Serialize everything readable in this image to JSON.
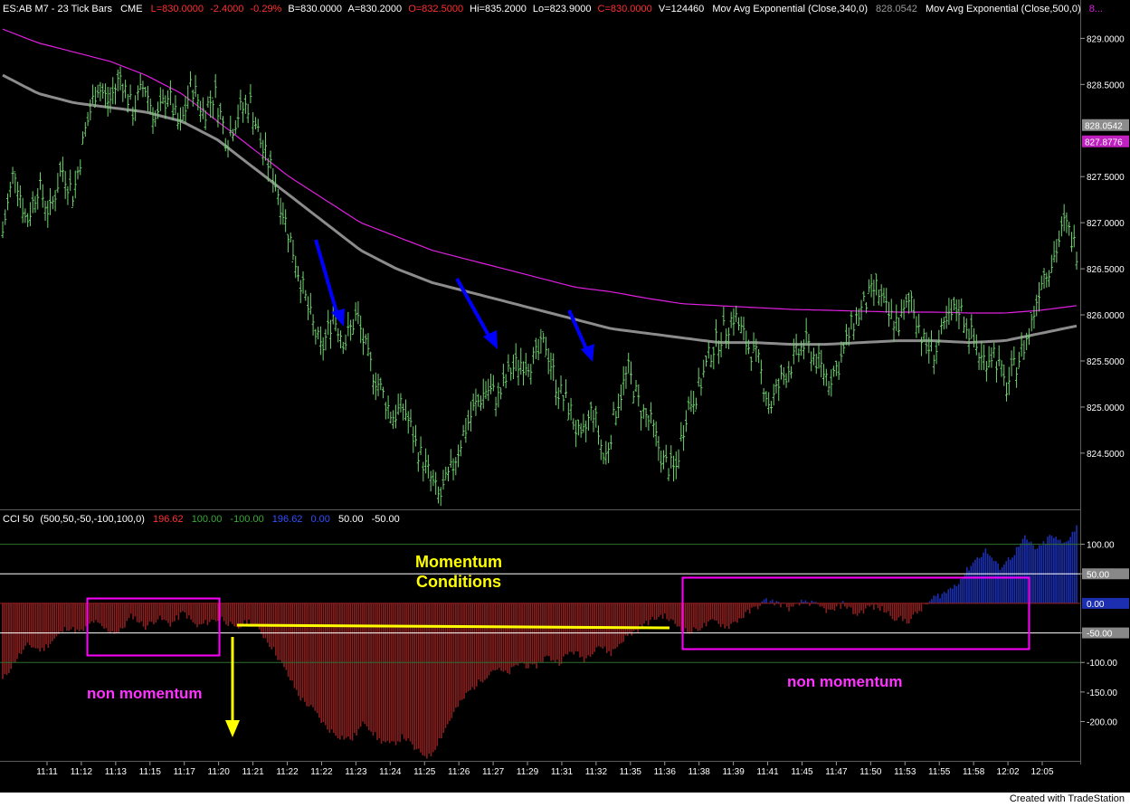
{
  "header": {
    "symbol": "ES:AB M7 - 23 Tick Bars",
    "exchange": "CME",
    "last": "L=830.0000",
    "change": "-2.4000",
    "change_pct": "-0.29%",
    "bid": "B=830.0000",
    "ask": "A=830.2000",
    "open": "O=832.5000",
    "high": "Hi=835.2000",
    "low": "Lo=823.9000",
    "close": "C=830.0000",
    "volume": "V=124460",
    "ma1_label": "Mov Avg Exponential (Close,340,0)",
    "ma1_value": "828.0542",
    "ma2_label": "Mov Avg Exponential (Close,500,0)",
    "ma2_value": "8..."
  },
  "cci_header": {
    "label": "CCI 50",
    "params": "(500,50,-50,-100,100,0)",
    "v1": "196.62",
    "v2": "100.00",
    "v3": "-100.00",
    "v4": "196.62",
    "v5": "0.00",
    "v6": "50.00",
    "v7": "-50.00"
  },
  "annotations": {
    "momentum": "Momentum",
    "conditions": "Conditions",
    "non_momentum_left": "non momentum",
    "non_momentum_right": "non momentum"
  },
  "footer": "Created with TradeStation",
  "colors": {
    "price": "#6fd36f",
    "ema340": "#8c8c8c",
    "ema500": "#e020e0",
    "cci_neg": "#8a2020",
    "cci_pos": "#1c2fb0",
    "highlight": "#ff00ff",
    "yellow": "#ffff00",
    "arrow": "#0000ff"
  },
  "chart_data": [
    {
      "type": "line",
      "series_kind": "ohlc_tick_bars",
      "x_labels": [
        "11:11",
        "11:12",
        "11:13",
        "11:15",
        "11:17",
        "11:20",
        "11:21",
        "11:22",
        "11:22",
        "11:23",
        "11:24",
        "11:25",
        "11:26",
        "11:27",
        "11:29",
        "11:31",
        "11:32",
        "11:35",
        "11:36",
        "11:38",
        "11:39",
        "11:41",
        "11:45",
        "11:47",
        "11:50",
        "11:53",
        "11:55",
        "11:58",
        "12:02",
        "12:05"
      ],
      "y_ticks": [
        "829.0000",
        "828.5000",
        "827.5000",
        "827.0000",
        "826.5000",
        "826.0000",
        "825.5000",
        "825.0000",
        "824.5000"
      ],
      "y_tick_values": [
        829.0,
        828.5,
        827.5,
        827.0,
        826.5,
        826.0,
        825.5,
        825.0,
        824.5
      ],
      "ylim": [
        823.9,
        829.2
      ],
      "price_markers": [
        {
          "label": "828.0542",
          "value": 828.0542,
          "color": "#8c8c8c"
        },
        {
          "label": "827.8776",
          "value": 827.8776,
          "color": "#c020c0"
        }
      ],
      "price_path": [
        826.9,
        827.6,
        827.0,
        827.4,
        827.1,
        827.6,
        827.3,
        828.0,
        828.5,
        828.3,
        828.6,
        828.2,
        828.5,
        828.1,
        828.4,
        828.0,
        828.5,
        828.2,
        828.4,
        827.9,
        828.2,
        828.3,
        827.8,
        827.5,
        827.0,
        826.5,
        826.0,
        825.6,
        826.0,
        825.7,
        826.0,
        825.5,
        825.2,
        824.9,
        825.0,
        824.6,
        824.3,
        824.0,
        824.3,
        824.7,
        825.0,
        825.2,
        825.1,
        825.4,
        825.5,
        825.5,
        825.7,
        825.2,
        825.0,
        824.6,
        825.0,
        824.4,
        825.0,
        825.4,
        825.0,
        824.8,
        824.4,
        824.3,
        825.0,
        825.2,
        825.6,
        825.8,
        826.0,
        825.7,
        825.5,
        825.0,
        825.3,
        825.5,
        825.7,
        825.5,
        825.3,
        825.5,
        825.9,
        826.1,
        826.3,
        826.0,
        825.9,
        826.2,
        825.7,
        825.6,
        825.9,
        826.1,
        825.8,
        825.5,
        825.6,
        825.2,
        825.5,
        825.8,
        826.4,
        826.6,
        827.0,
        826.7
      ],
      "series": [
        {
          "name": "Mov Avg Exponential (Close,340,0)",
          "values": [
            828.6,
            828.4,
            828.3,
            828.25,
            828.2,
            828.1,
            827.9,
            827.6,
            827.3,
            827.0,
            826.7,
            826.5,
            826.35,
            826.25,
            826.15,
            826.05,
            825.95,
            825.85,
            825.8,
            825.75,
            825.7,
            825.7,
            825.68,
            825.68,
            825.7,
            825.72,
            825.72,
            825.7,
            825.72,
            825.8,
            825.88
          ]
        },
        {
          "name": "Mov Avg Exponential (Close,500,0)",
          "values": [
            829.1,
            828.95,
            828.85,
            828.75,
            828.6,
            828.4,
            828.1,
            827.8,
            827.5,
            827.25,
            827.0,
            826.85,
            826.7,
            826.6,
            826.5,
            826.4,
            826.3,
            826.25,
            826.18,
            826.12,
            826.1,
            826.08,
            826.06,
            826.05,
            826.04,
            826.03,
            826.03,
            826.02,
            826.02,
            826.05,
            826.1
          ]
        }
      ]
    },
    {
      "type": "area",
      "title": "CCI 50",
      "y_ticks": [
        "100.00",
        "50.00",
        "-50.00",
        "-100.00",
        "-150.00",
        "-200.00"
      ],
      "y_tick_values": [
        100,
        50,
        -50,
        -100,
        -150,
        -200
      ],
      "ylim": [
        -265,
        130
      ],
      "levels": [
        100,
        50,
        0,
        -50,
        -100
      ],
      "right_markers": [
        {
          "label": "50.00",
          "value": 50
        },
        {
          "label": "0.00",
          "value": 0
        },
        {
          "label": "-50.00",
          "value": -50
        }
      ],
      "values": [
        -130,
        -95,
        -70,
        -80,
        -60,
        -40,
        -50,
        -30,
        -45,
        -50,
        -20,
        -40,
        -25,
        -35,
        -15,
        -40,
        -30,
        -25,
        -45,
        -30,
        -50,
        -80,
        -120,
        -160,
        -180,
        -210,
        -225,
        -230,
        -200,
        -230,
        -240,
        -225,
        -250,
        -260,
        -220,
        -180,
        -150,
        -130,
        -110,
        -120,
        -100,
        -110,
        -90,
        -100,
        -80,
        -95,
        -70,
        -85,
        -60,
        -45,
        -30,
        -20,
        -35,
        -50,
        -40,
        -30,
        -40,
        -25,
        -10,
        5,
        0,
        -10,
        5,
        -5,
        -15,
        0,
        -20,
        -5,
        -10,
        -25,
        -30,
        -10,
        10,
        20,
        40,
        70,
        90,
        60,
        80,
        110,
        90,
        115,
        100,
        130
      ]
    }
  ]
}
